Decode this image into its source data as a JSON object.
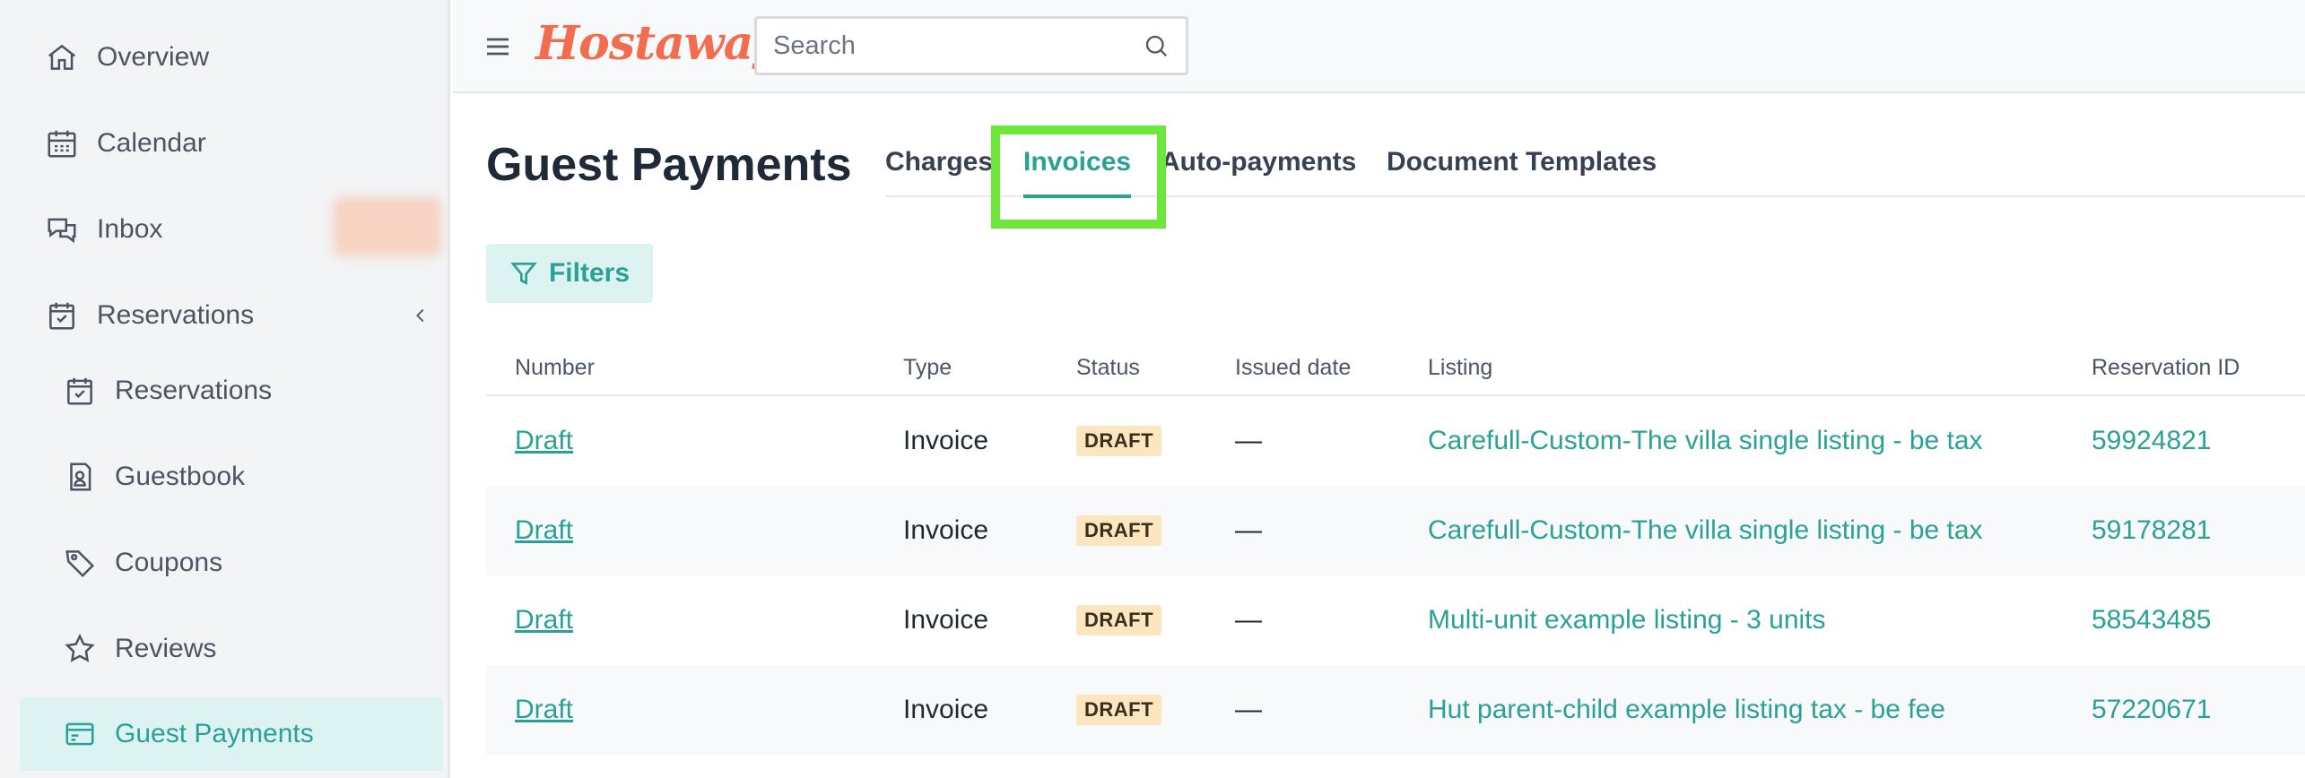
{
  "sidebar": {
    "items": [
      {
        "label": "Overview",
        "icon": "home-icon"
      },
      {
        "label": "Calendar",
        "icon": "calendar-icon"
      },
      {
        "label": "Inbox",
        "icon": "chat-icon"
      },
      {
        "label": "Reservations",
        "icon": "calendar-check-icon"
      },
      {
        "label": "Reservations",
        "icon": "calendar-check-icon"
      },
      {
        "label": "Guestbook",
        "icon": "contact-book-icon"
      },
      {
        "label": "Coupons",
        "icon": "tag-icon"
      },
      {
        "label": "Reviews",
        "icon": "star-icon"
      },
      {
        "label": "Guest Payments",
        "icon": "credit-card-icon"
      }
    ]
  },
  "header": {
    "logo": "Hostaway",
    "search_placeholder": "Search"
  },
  "main": {
    "title": "Guest Payments",
    "tabs": [
      {
        "label": "Charges"
      },
      {
        "label": "Invoices"
      },
      {
        "label": "Auto-payments"
      },
      {
        "label": "Document Templates"
      }
    ],
    "active_tab": "Invoices",
    "filters_label": "Filters"
  },
  "table": {
    "columns": [
      "Number",
      "Type",
      "Status",
      "Issued date",
      "Listing",
      "Reservation ID"
    ],
    "rows": [
      {
        "number": "Draft",
        "type": "Invoice",
        "status": "DRAFT",
        "issued": "—",
        "listing": "Carefull-Custom-The villa single listing - be tax",
        "reservation": "59924821"
      },
      {
        "number": "Draft",
        "type": "Invoice",
        "status": "DRAFT",
        "issued": "—",
        "listing": "Carefull-Custom-The villa single listing - be tax",
        "reservation": "59178281"
      },
      {
        "number": "Draft",
        "type": "Invoice",
        "status": "DRAFT",
        "issued": "—",
        "listing": "Multi-unit example listing - 3 units",
        "reservation": "58543485"
      },
      {
        "number": "Draft",
        "type": "Invoice",
        "status": "DRAFT",
        "issued": "—",
        "listing": "Hut parent-child example listing tax - be fee",
        "reservation": "57220671"
      }
    ]
  },
  "colors": {
    "accent": "#2aa197",
    "accent_bg": "#ddf3f1",
    "logo": "#f26c4f",
    "highlight": "#6ee73b",
    "draft_badge_bg": "#fbe6bf"
  }
}
